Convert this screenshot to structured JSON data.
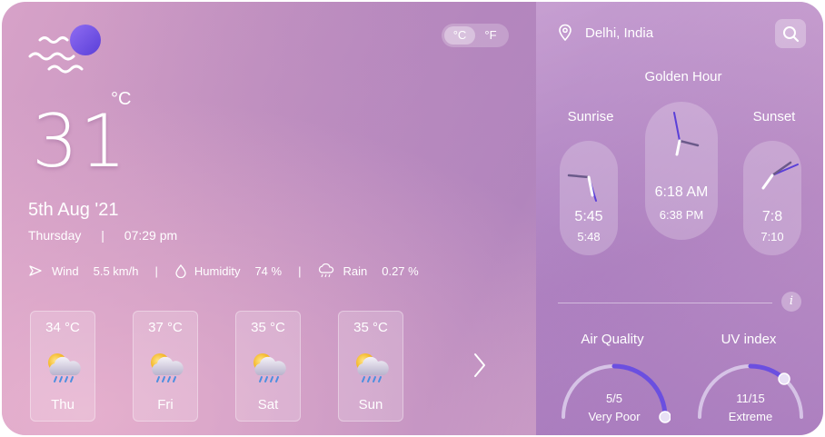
{
  "current": {
    "temperature": "31",
    "unit_symbol": "°C",
    "date": "5th Aug '21",
    "weekday": "Thursday",
    "separator": "|",
    "time": "07:29 pm",
    "icon": "moon-waves-icon"
  },
  "unit_toggle": {
    "celsius": "°C",
    "fahrenheit": "°F",
    "selected": "°C"
  },
  "stats": {
    "wind_label": "Wind",
    "wind_value": "5.5 km/h",
    "humidity_label": "Humidity",
    "humidity_value": "74 %",
    "rain_label": "Rain",
    "rain_value": "0.27 %",
    "separator": "|"
  },
  "forecast": [
    {
      "temp": "34 °C",
      "day": "Thu",
      "icon": "cloud-sun-rain-icon"
    },
    {
      "temp": "37 °C",
      "day": "Fri",
      "icon": "cloud-sun-rain-icon"
    },
    {
      "temp": "35 °C",
      "day": "Sat",
      "icon": "cloud-sun-rain-icon"
    },
    {
      "temp": "35 °C",
      "day": "Sun",
      "icon": "cloud-sun-rain-icon"
    }
  ],
  "location": {
    "name": "Delhi, India"
  },
  "golden_hour": {
    "title": "Golden Hour",
    "sunrise": {
      "label": "Sunrise",
      "primary": "5:45",
      "secondary": "5:48"
    },
    "center": {
      "primary": "6:18 AM",
      "secondary": "6:38 PM"
    },
    "sunset": {
      "label": "Sunset",
      "primary": "7:8",
      "secondary": "7:10"
    }
  },
  "air_quality": {
    "label": "Air Quality",
    "value": "5/5",
    "status": "Very Poor",
    "level": 1.0
  },
  "uv_index": {
    "label": "UV index",
    "value": "11/15",
    "status": "Extreme",
    "level": 0.73
  },
  "colors": {
    "accent": "#6b4fe0",
    "gauge_track": "#d6c3e6"
  }
}
